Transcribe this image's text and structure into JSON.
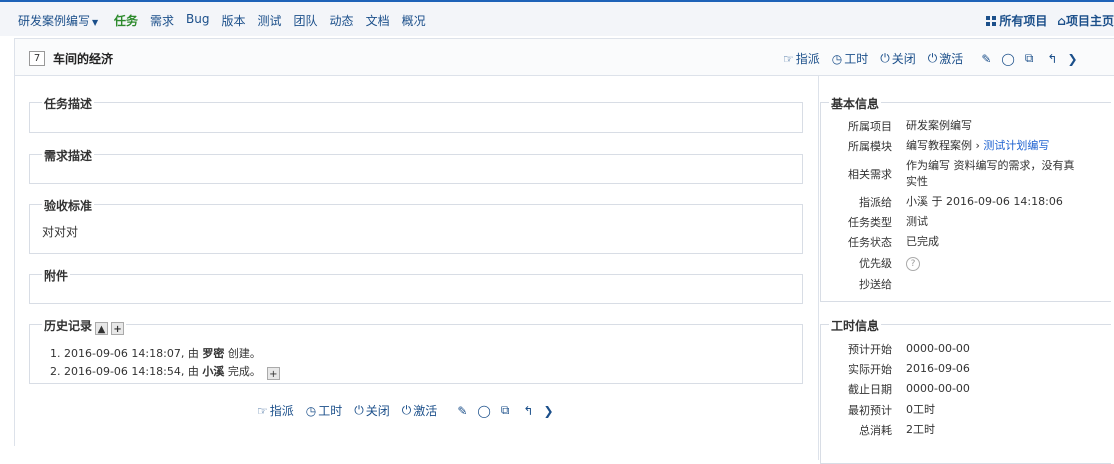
{
  "nav": {
    "project": "研发案例编写",
    "menu": [
      {
        "label": "任务",
        "active": true
      },
      {
        "label": "需求",
        "active": false
      },
      {
        "label": "Bug",
        "active": false
      },
      {
        "label": "版本",
        "active": false
      },
      {
        "label": "测试",
        "active": false
      },
      {
        "label": "团队",
        "active": false
      },
      {
        "label": "动态",
        "active": false
      },
      {
        "label": "文档",
        "active": false
      },
      {
        "label": "概况",
        "active": false
      }
    ],
    "all_projects": "所有项目",
    "project_home": "项目主页"
  },
  "task": {
    "id": "7",
    "title": "车间的经济"
  },
  "actions": {
    "assign": "指派",
    "effort": "工时",
    "close": "关闭",
    "activate": "激活"
  },
  "sections": {
    "desc": {
      "legend": "任务描述",
      "content": ""
    },
    "story": {
      "legend": "需求描述",
      "content": ""
    },
    "verify": {
      "legend": "验收标准",
      "content": "对对对"
    },
    "files": {
      "legend": "附件",
      "content": ""
    }
  },
  "history": {
    "legend": "历史记录",
    "entries": [
      {
        "num": "1.",
        "time": "2016-09-06 14:18:07, 由",
        "actor": "罗密",
        "action": "创建。"
      },
      {
        "num": "2.",
        "time": "2016-09-06 14:18:54, 由",
        "actor": "小溪",
        "action": "完成。"
      }
    ]
  },
  "basic": {
    "legend": "基本信息",
    "project_label": "所属项目",
    "project_value": "研发案例编写",
    "module_label": "所属模块",
    "module_value": "编写教程案例",
    "module_sep": "›",
    "module_child": "测试计划编写",
    "story_label": "相关需求",
    "story_value": "作为编写 资料编写的需求，没有真实性",
    "assigned_label": "指派给",
    "assigned_value": "小溪 于 2016-09-06 14:18:06",
    "type_label": "任务类型",
    "type_value": "测试",
    "status_label": "任务状态",
    "status_value": "已完成",
    "priority_label": "优先级",
    "priority_value": "?",
    "cc_label": "抄送给",
    "cc_value": ""
  },
  "effort": {
    "legend": "工时信息",
    "est_start_label": "预计开始",
    "est_start_value": "0000-00-00",
    "real_start_label": "实际开始",
    "real_start_value": "2016-09-06",
    "deadline_label": "截止日期",
    "deadline_value": "0000-00-00",
    "estimate_label": "最初预计",
    "estimate_value": "0工时",
    "consumed_label": "总消耗",
    "consumed_value": "2工时"
  }
}
